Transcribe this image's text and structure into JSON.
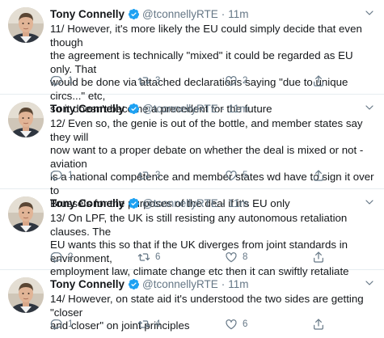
{
  "author": {
    "name": "Tony Connelly",
    "handle": "@tconnellyRTE",
    "separator": "·"
  },
  "icons": {
    "verified": "verified-badge-icon",
    "reply": "reply-icon",
    "retweet": "retweet-icon",
    "like": "heart-icon",
    "share": "share-icon",
    "caret": "chevron-down-icon"
  },
  "colors": {
    "verified": "#1da1f2",
    "icon_gray": "#657786",
    "divider": "#e6ecf0"
  },
  "tweets": [
    {
      "time": "11m",
      "text": "11/ However, it's more likely the EU could simply decide that even though\nthe agreement is technically \"mixed\" it could be regarded as EU only. That\nwould be done via attached declarations saying \"due to unique circs...\" etc,\nso it doesn't become a precedent for the future",
      "replies": "1",
      "retweets": "3",
      "likes": "2"
    },
    {
      "time": "11m",
      "text": "12/ Even so, the genie is out of the bottle, and member states say they will\nnow want to a proper debate on whether the deal is mixed or not - aviation\nis a national competence and member states wd have to sign it over to\nBrussels for the purposes of the deal if it's EU only",
      "replies": "1",
      "retweets": "3",
      "likes": "5"
    },
    {
      "time": "11m",
      "text": "13/ On LPF, the UK is still resisting any autonomous retaliation clauses. The\nEU wants this so that if the UK diverges from joint standards in environment,\nemployment law, climate change etc then it can swiftly retaliate",
      "replies": "2",
      "retweets": "6",
      "likes": "8"
    },
    {
      "time": "11m",
      "text": "14/ However, on state aid it's understood the two sides are getting \"closer\nand closer\" on joint principles",
      "replies": "1",
      "retweets": "4",
      "likes": "6"
    }
  ]
}
